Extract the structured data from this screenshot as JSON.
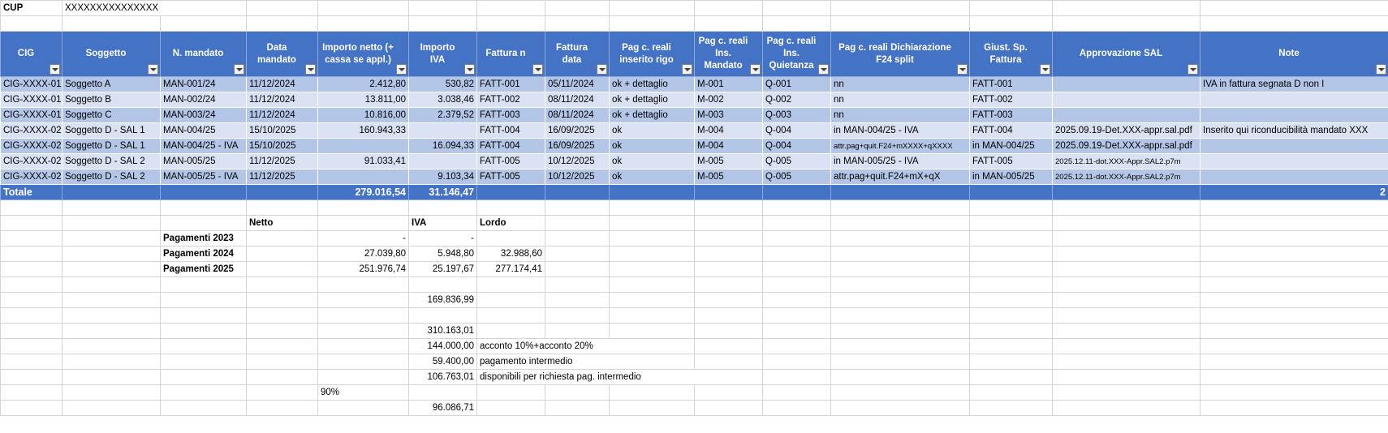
{
  "cup": {
    "label": "CUP",
    "value": "XXXXXXXXXXXXXXX"
  },
  "headers": [
    "CIG",
    "Soggetto",
    "N. mandato",
    "Data mandato",
    "Importo netto (+ cassa se appl.)",
    "Importo IVA",
    "Fattura n",
    "Fattura data",
    "Pag c. reali inserito rigo",
    "Pag c. reali Ins. Mandato",
    "Pag c. reali Ins. Quietanza",
    "Pag c. reali Dichiarazione F24 split",
    "Giust. Sp. Fattura",
    "Approvazione SAL",
    "Note"
  ],
  "rows": [
    {
      "cig": "CIG-XXXX-01",
      "sogg": "Soggetto A",
      "mand": "MAN-001/24",
      "data": "11/12/2024",
      "netto": "2.412,80",
      "iva": "530,82",
      "fatt": "FATT-001",
      "fdata": "05/11/2024",
      "rigo": "ok + dettaglio",
      "insm": "M-001",
      "insq": "Q-001",
      "f24": "nn",
      "giust": "FATT-001",
      "sal": "",
      "note": "IVA in fattura segnata D non I"
    },
    {
      "cig": "CIG-XXXX-01",
      "sogg": "Soggetto B",
      "mand": "MAN-002/24",
      "data": "11/12/2024",
      "netto": "13.811,00",
      "iva": "3.038,46",
      "fatt": "FATT-002",
      "fdata": "08/11/2024",
      "rigo": "ok + dettaglio",
      "insm": "M-002",
      "insq": "Q-002",
      "f24": "nn",
      "giust": "FATT-002",
      "sal": "",
      "note": ""
    },
    {
      "cig": "CIG-XXXX-01",
      "sogg": "Soggetto C",
      "mand": "MAN-003/24",
      "data": "11/12/2024",
      "netto": "10.816,00",
      "iva": "2.379,52",
      "fatt": "FATT-003",
      "fdata": "08/11/2024",
      "rigo": "ok + dettaglio",
      "insm": "M-003",
      "insq": "Q-003",
      "f24": "nn",
      "giust": "FATT-003",
      "sal": "",
      "note": ""
    },
    {
      "cig": "CIG-XXXX-02",
      "sogg": "Soggetto D - SAL 1",
      "mand": "MAN-004/25",
      "data": "15/10/2025",
      "netto": "160.943,33",
      "iva": "",
      "fatt": "FATT-004",
      "fdata": "16/09/2025",
      "rigo": "ok",
      "insm": "M-004",
      "insq": "Q-004",
      "f24": "in MAN-004/25 - IVA",
      "giust": "FATT-004",
      "sal": "2025.09.19-Det.XXX-appr.sal.pdf",
      "note": "Inserito qui riconducibilità mandato XXX"
    },
    {
      "cig": "CIG-XXXX-02",
      "sogg": "Soggetto D - SAL 1",
      "mand": "MAN-004/25 - IVA",
      "data": "15/10/2025",
      "netto": "",
      "iva": "16.094,33",
      "fatt": "FATT-004",
      "fdata": "16/09/2025",
      "rigo": "ok",
      "insm": "M-004",
      "insq": "Q-004",
      "f24": "attr.pag+quit.F24+mXXXX+qXXXX",
      "giust": "in MAN-004/25",
      "sal": "2025.09.19-Det.XXX-appr.sal.pdf",
      "note": ""
    },
    {
      "cig": "CIG-XXXX-02",
      "sogg": "Soggetto D - SAL 2",
      "mand": "MAN-005/25",
      "data": "11/12/2025",
      "netto": "91.033,41",
      "iva": "",
      "fatt": "FATT-005",
      "fdata": "10/12/2025",
      "rigo": "ok",
      "insm": "M-005",
      "insq": "Q-005",
      "f24": "in MAN-005/25 - IVA",
      "giust": "FATT-005",
      "sal": "2025.12.11-dot.XXX-Appr.SAL2.p7m",
      "note": ""
    },
    {
      "cig": "CIG-XXXX-02",
      "sogg": "Soggetto D - SAL 2",
      "mand": "MAN-005/25 - IVA",
      "data": "11/12/2025",
      "netto": "",
      "iva": "9.103,34",
      "fatt": "FATT-005",
      "fdata": "10/12/2025",
      "rigo": "ok",
      "insm": "M-005",
      "insq": "Q-005",
      "f24": "attr.pag+quit.F24+mX+qX",
      "giust": "in MAN-005/25",
      "sal": "2025.12.11-dot.XXX-Appr.SAL2.p7m",
      "note": ""
    }
  ],
  "totals": {
    "label": "Totale",
    "netto": "279.016,54",
    "iva": "31.146,47",
    "note": "2"
  },
  "summary": {
    "h_netto": "Netto",
    "h_iva": "IVA",
    "h_lordo": "Lordo",
    "p2023": {
      "label": "Pagamenti 2023",
      "netto": "-",
      "iva": "-",
      "lordo": ""
    },
    "p2024": {
      "label": "Pagamenti 2024",
      "netto": "27.039,80",
      "iva": "5.948,80",
      "lordo": "32.988,60"
    },
    "p2025": {
      "label": "Pagamenti 2025",
      "netto": "251.976,74",
      "iva": "25.197,67",
      "lordo": "277.174,41"
    }
  },
  "calc": {
    "v1": "169.836,99",
    "v2": "310.163,01",
    "v3": "144.000,00",
    "t3": "acconto 10%+acconto 20%",
    "v4": "59.400,00",
    "t4": "pagamento intermedio",
    "v5": "106.763,01",
    "t5": "disponibili per richiesta pag. intermedio",
    "pct": "90%",
    "v6": "96.086,71"
  }
}
